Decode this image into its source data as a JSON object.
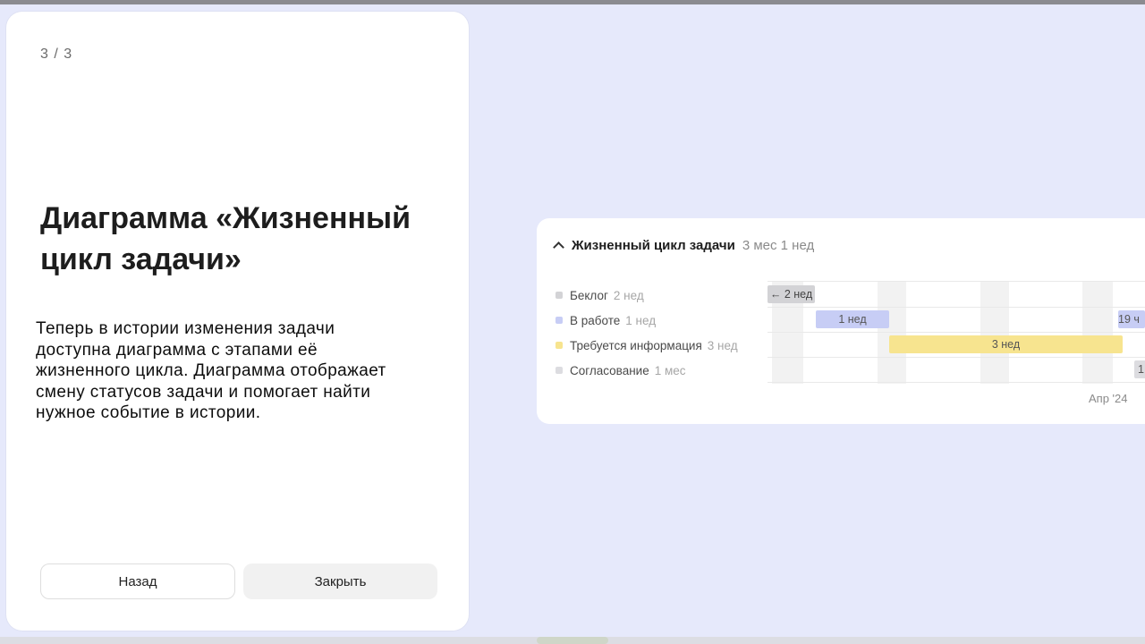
{
  "onboarding": {
    "step": "3 / 3",
    "title": "Диаграмма «Жизненный цикл задачи»",
    "description": "Теперь в истории изменения задачи\nдоступна диаграмма с этапами её\nжизненного цикла. Диаграмма отображает\n смену статусов задачи и помогает найти\nнужное событие в истории.",
    "back_label": "Назад",
    "close_label": "Закрыть"
  },
  "lifecycle": {
    "title": "Жизненный цикл задачи",
    "total": "3 мес 1 нед",
    "statuses": [
      {
        "name": "Беклог",
        "duration": "2 нед",
        "color": "#d3d3d6"
      },
      {
        "name": "В работе",
        "duration": "1 нед",
        "color": "#c7cdf5"
      },
      {
        "name": "Требуется информация",
        "duration": "3 нед",
        "color": "#f7e48f"
      },
      {
        "name": "Согласование",
        "duration": "1 мес",
        "color": "#dcdce0"
      }
    ],
    "bars": {
      "backlog": "← 2 нед",
      "in_work": "1 нед",
      "in_work_2": "19 ч",
      "info": "3 нед",
      "approval": "1"
    },
    "axis_label": "Апр '24"
  }
}
